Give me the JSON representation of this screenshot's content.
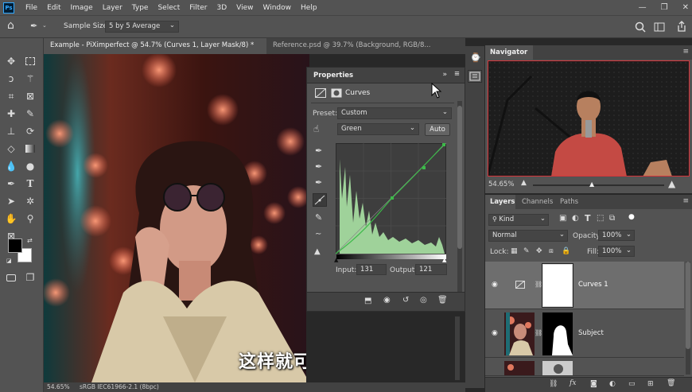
{
  "app": {
    "menu": [
      "File",
      "Edit",
      "Image",
      "Layer",
      "Type",
      "Select",
      "Filter",
      "3D",
      "View",
      "Window",
      "Help"
    ]
  },
  "options_bar": {
    "sample_size_label": "Sample Size:",
    "sample_size_value": "5 by 5 Average"
  },
  "document_tabs": [
    {
      "label": "Example - PiXimperfect @ 54.7% (Curves 1, Layer Mask/8) *",
      "active": true
    },
    {
      "label": "Reference.psd @ 39.7% (Background, RGB/8...",
      "active": false
    }
  ],
  "status": {
    "zoom": "54.65%",
    "profile": "sRGB IEC61966-2.1 (8bpc)"
  },
  "subtitle": "这样就可以了",
  "properties": {
    "title": "Properties",
    "adjustment_name": "Curves",
    "preset_label": "Preset:",
    "preset_value": "Custom",
    "channel_value": "Green",
    "auto_label": "Auto",
    "input_label": "Input:",
    "input_value": "131",
    "output_label": "Output:",
    "output_value": "121"
  },
  "navigator": {
    "title": "Navigator",
    "zoom": "54.65%"
  },
  "layers_panel": {
    "tabs": [
      "Layers",
      "Channels",
      "Paths"
    ],
    "filter_kind": "Kind",
    "blend_mode": "Normal",
    "opacity_label": "Opacity:",
    "opacity_value": "100%",
    "lock_label": "Lock:",
    "fill_label": "Fill:",
    "fill_value": "100%",
    "layers": [
      {
        "name": "Curves 1",
        "selected": true
      },
      {
        "name": "Subject",
        "selected": false
      }
    ]
  },
  "colors": {
    "panel_bg": "#535353",
    "dark_bg": "#424242",
    "accent": "#31a8ff",
    "histogram": "#9fd29a"
  }
}
